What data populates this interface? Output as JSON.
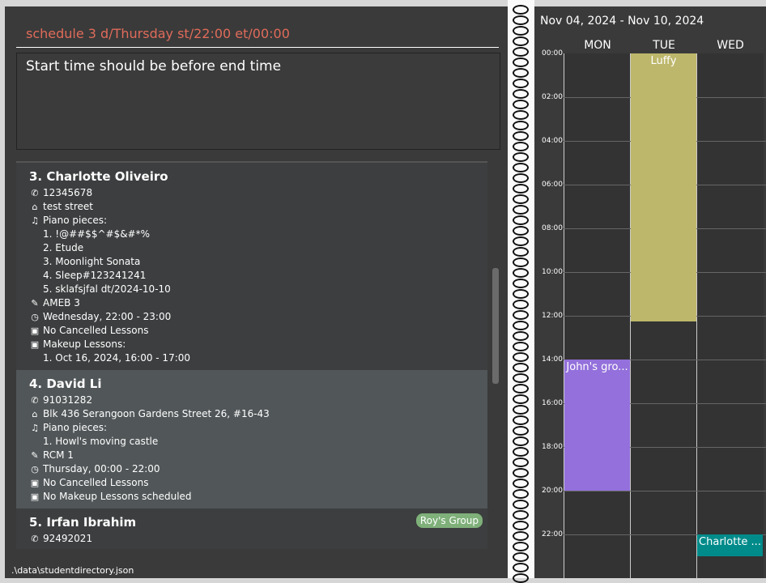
{
  "command": "schedule 3 d/Thursday st/22:00 et/00:00",
  "result": "Start time should be before end time",
  "status_path": ".\\data\\studentdirectory.json",
  "students": [
    {
      "name": "3. Charlotte Oliveiro",
      "phone": "12345678",
      "address": "test street",
      "pieces_label": "Piano pieces:",
      "pieces": [
        "1. !@##$$^#$&#*%",
        "2. Etude",
        "3. Moonlight Sonata",
        "4. Sleep#123241241",
        "5. sklafsjfal dt/2024-10-10"
      ],
      "grade": "AMEB 3",
      "schedule": "Wednesday, 22:00 - 23:00",
      "cancelled": "No Cancelled Lessons",
      "makeup_label": "Makeup Lessons:",
      "makeup": [
        "1. Oct 16, 2024, 16:00 - 17:00"
      ]
    },
    {
      "name": "4. David Li",
      "phone": "91031282",
      "address": "Blk 436 Serangoon Gardens Street 26, #16-43",
      "pieces_label": "Piano pieces:",
      "pieces": [
        "1. Howl's moving castle"
      ],
      "grade": "RCM 1",
      "schedule": "Thursday, 00:00 - 22:00",
      "cancelled": "No Cancelled Lessons",
      "makeup_label": "No Makeup Lessons scheduled"
    },
    {
      "name": "5. Irfan Ibrahim",
      "phone": "92492021",
      "tag": "Roy's Group"
    }
  ],
  "calendar": {
    "range": "Nov 04, 2024 - Nov 10, 2024",
    "days": [
      "MON",
      "TUE",
      "WED"
    ],
    "times": [
      "00:00",
      "02:00",
      "04:00",
      "06:00",
      "08:00",
      "10:00",
      "12:00",
      "14:00",
      "16:00",
      "18:00",
      "20:00",
      "22:00"
    ],
    "events": [
      {
        "label": "Luffy",
        "day": 1,
        "start": 0,
        "end": 12.25,
        "color": "#bdb76b"
      },
      {
        "label": "John's gro...",
        "day": 0,
        "start": 14,
        "end": 20,
        "color": "#9370db"
      },
      {
        "label": "Charlotte ...",
        "day": 2,
        "start": 22,
        "end": 23,
        "color": "#008b8b"
      }
    ]
  },
  "icons": [
    "phone-icon",
    "home-icon",
    "music-icon",
    "grad-cap-icon",
    "clock-icon",
    "lesson-icon"
  ]
}
